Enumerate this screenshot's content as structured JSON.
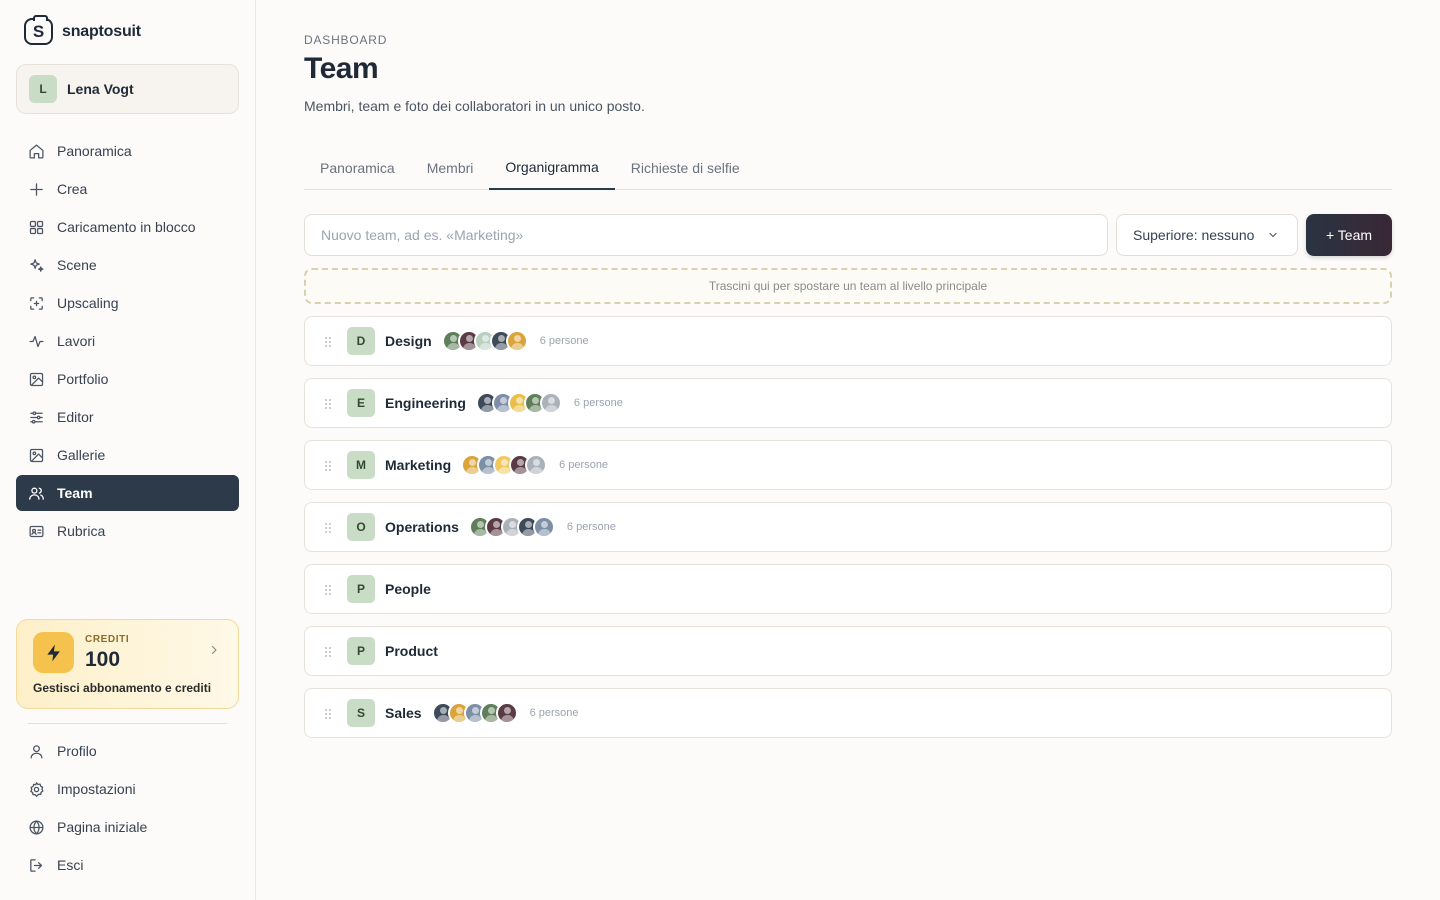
{
  "brand": {
    "name": "snaptosuit",
    "logo_letter": "S"
  },
  "user": {
    "initial": "L",
    "name": "Lena Vogt"
  },
  "nav": {
    "items": [
      {
        "label": "Panoramica",
        "icon": "home-icon"
      },
      {
        "label": "Crea",
        "icon": "plus-icon"
      },
      {
        "label": "Caricamento in blocco",
        "icon": "grid-icon"
      },
      {
        "label": "Scene",
        "icon": "sparkles-icon"
      },
      {
        "label": "Upscaling",
        "icon": "scan-icon"
      },
      {
        "label": "Lavori",
        "icon": "activity-icon"
      },
      {
        "label": "Portfolio",
        "icon": "image-icon"
      },
      {
        "label": "Editor",
        "icon": "sliders-icon"
      },
      {
        "label": "Gallerie",
        "icon": "gallery-icon"
      },
      {
        "label": "Team",
        "icon": "users-icon",
        "active": true
      },
      {
        "label": "Rubrica",
        "icon": "contact-card-icon"
      }
    ],
    "bottom": [
      {
        "label": "Profilo",
        "icon": "user-icon"
      },
      {
        "label": "Impostazioni",
        "icon": "gear-icon"
      },
      {
        "label": "Pagina iniziale",
        "icon": "globe-icon"
      },
      {
        "label": "Esci",
        "icon": "logout-icon"
      }
    ]
  },
  "credits": {
    "label": "CREDITI",
    "value": "100",
    "manage": "Gestisci abbonamento e crediti",
    "icon": "lightning-icon"
  },
  "header": {
    "eyebrow": "DASHBOARD",
    "title": "Team",
    "subtitle": "Membri, team e foto dei collaboratori in un unico posto."
  },
  "tabs": [
    {
      "label": "Panoramica"
    },
    {
      "label": "Membri"
    },
    {
      "label": "Organigramma",
      "active": true
    },
    {
      "label": "Richieste di selfie"
    }
  ],
  "toolbar": {
    "new_team_placeholder": "Nuovo team, ad es. «Marketing»",
    "parent_select": "Superiore: nessuno",
    "add_team": "+ Team"
  },
  "dropzone": "Trascini qui per spostare un team al livello principale",
  "teams": [
    {
      "initial": "D",
      "name": "Design",
      "count": "6 persone",
      "avatars": [
        "#5f7f5a",
        "#5a3a45",
        "#b9cfc0",
        "#3e4a5a",
        "#d9a53b"
      ]
    },
    {
      "initial": "E",
      "name": "Engineering",
      "count": "6 persone",
      "avatars": [
        "#3e4a5a",
        "#7c8fa6",
        "#e9be4a",
        "#5f7f5a",
        "#aab1bb"
      ]
    },
    {
      "initial": "M",
      "name": "Marketing",
      "count": "6 persone",
      "avatars": [
        "#d9a53b",
        "#7c8fa6",
        "#f0c85e",
        "#5a3a45",
        "#aab1bb"
      ]
    },
    {
      "initial": "O",
      "name": "Operations",
      "count": "6 persone",
      "avatars": [
        "#5f7f5a",
        "#5a3a45",
        "#aab1bb",
        "#3e4a5a",
        "#7c8fa6"
      ]
    },
    {
      "initial": "P",
      "name": "People",
      "count": "",
      "avatars": []
    },
    {
      "initial": "P",
      "name": "Product",
      "count": "",
      "avatars": []
    },
    {
      "initial": "S",
      "name": "Sales",
      "count": "6 persone",
      "avatars": [
        "#3e4a5a",
        "#d9a53b",
        "#7c8fa6",
        "#5f7f5a",
        "#5a3a45"
      ]
    }
  ]
}
